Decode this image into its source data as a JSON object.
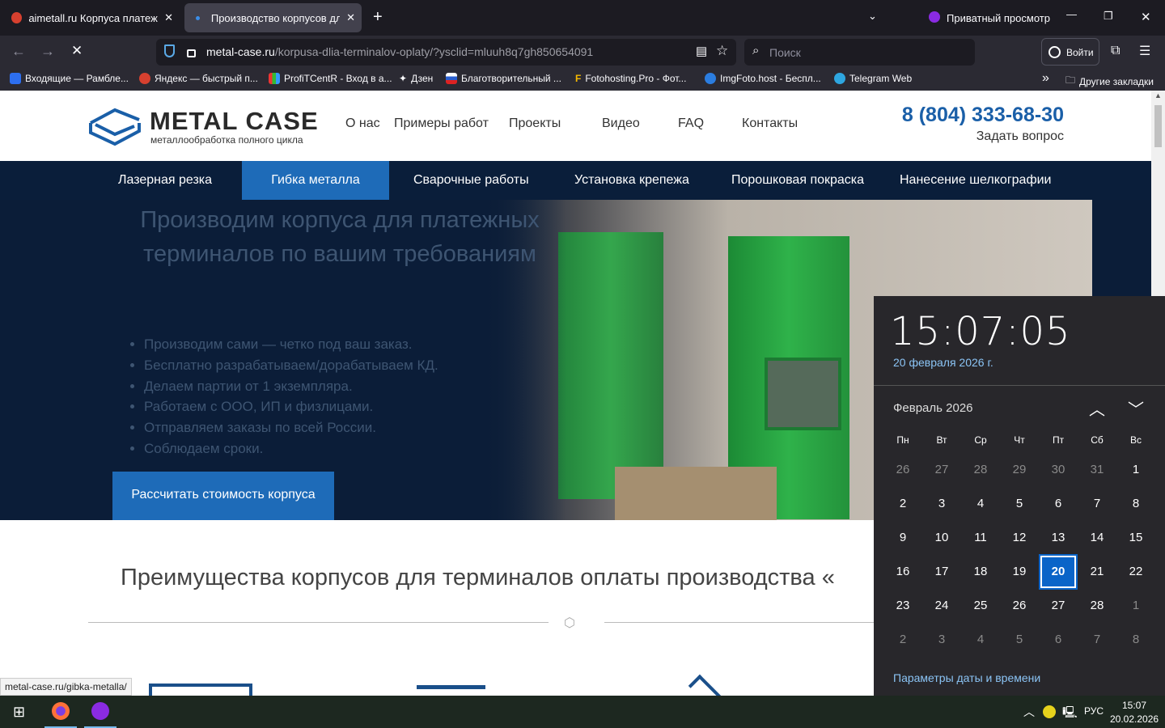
{
  "browser": {
    "tabs": [
      {
        "title": "aimetall.ru Корпуса платежных",
        "active": false
      },
      {
        "title": "Производство корпусов для те",
        "active": true
      }
    ],
    "private_label": "Приватный просмотр",
    "url_host": "metal-case.ru",
    "url_path": "/korpusa-dlia-terminalov-oplaty/?ysclid=mluuh8q7gh850654091",
    "search_placeholder": "Поиск",
    "login_label": "Войти",
    "bookmarks": [
      "Входящие — Рамбле...",
      "Яндекс — быстрый п...",
      "ProfiTCentR - Вход в а...",
      "Дзен",
      "Благотворительный ...",
      "Fotohosting.Pro - Фот...",
      "ImgFoto.host - Беспл...",
      "Telegram Web"
    ],
    "other_bookmarks": "Другие закладки",
    "status_url": "metal-case.ru/gibka-metalla/"
  },
  "site": {
    "logo_title": "METAL CASE",
    "logo_sub": "металлообработка полного цикла",
    "menu": [
      "О нас",
      "Примеры работ",
      "Проекты",
      "Видео",
      "FAQ",
      "Контакты"
    ],
    "phone": "8 (804) 333-68-30",
    "ask": "Задать вопрос",
    "services": [
      "Лазерная резка",
      "Гибка металла",
      "Сварочные работы",
      "Установка крепежа",
      "Порошковая покраска",
      "Нанесение шелкографии"
    ],
    "active_service": "Гибка металла",
    "hero_title_1": "Производим корпуса для платежных",
    "hero_title_2": "терминалов по вашим требованиям",
    "bullets": [
      "Производим сами — четко под ваш заказ.",
      "Бесплатно разрабатываем/дорабатываем КД.",
      "Делаем партии от 1 экземпляра.",
      "Работаем с ООО, ИП и физлицами.",
      "Отправляем заказы по всей России.",
      "Соблюдаем сроки."
    ],
    "cta": "Рассчитать стоимость корпуса",
    "section_title": "Преимущества корпусов для терминалов оплаты производства «"
  },
  "calendar": {
    "time": "15:07:05",
    "date": "20 февраля 2026 г.",
    "month": "Февраль 2026",
    "weekdays": [
      "Пн",
      "Вт",
      "Ср",
      "Чт",
      "Пт",
      "Сб",
      "Вс"
    ],
    "weeks": [
      [
        "26",
        "27",
        "28",
        "29",
        "30",
        "31",
        "1"
      ],
      [
        "2",
        "3",
        "4",
        "5",
        "6",
        "7",
        "8"
      ],
      [
        "9",
        "10",
        "11",
        "12",
        "13",
        "14",
        "15"
      ],
      [
        "16",
        "17",
        "18",
        "19",
        "20",
        "21",
        "22"
      ],
      [
        "23",
        "24",
        "25",
        "26",
        "27",
        "28",
        "1"
      ],
      [
        "2",
        "3",
        "4",
        "5",
        "6",
        "7",
        "8"
      ]
    ],
    "selected": "20",
    "settings_link": "Параметры даты и времени"
  },
  "taskbar": {
    "lang": "РУС",
    "time": "15:07",
    "date": "20.02.2026"
  },
  "colors": {
    "accent": "#1e6bb8",
    "navy": "#0a1e3a",
    "phone": "#1a5fa8"
  }
}
